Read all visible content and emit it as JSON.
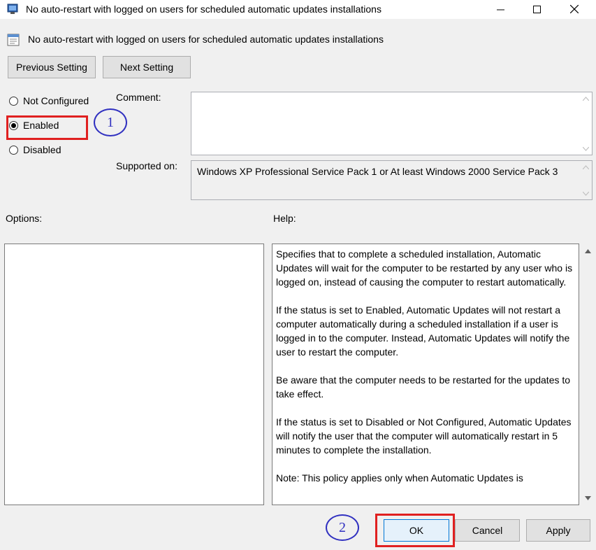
{
  "window": {
    "title": "No auto-restart with logged on users for scheduled automatic updates installations",
    "icons": {
      "app": "policy-icon",
      "minimize": "minimize-icon",
      "maximize": "maximize-icon",
      "close": "close-icon"
    }
  },
  "policy": {
    "name": "No auto-restart with logged on users for scheduled automatic updates installations"
  },
  "nav": {
    "previous_label": "Previous Setting",
    "next_label": "Next Setting"
  },
  "state": {
    "options": [
      {
        "label": "Not Configured",
        "checked": false
      },
      {
        "label": "Enabled",
        "checked": true
      },
      {
        "label": "Disabled",
        "checked": false
      }
    ]
  },
  "annotations": {
    "step1": "1",
    "step2": "2",
    "highlight_color": "#e02020",
    "step_color": "#3030c0"
  },
  "comment": {
    "label": "Comment:",
    "value": ""
  },
  "supported": {
    "label": "Supported on:",
    "value": "Windows XP Professional Service Pack 1 or At least Windows 2000 Service Pack 3"
  },
  "options_panel": {
    "label": "Options:"
  },
  "help_panel": {
    "label": "Help:",
    "paragraphs": [
      "Specifies that to complete a scheduled installation, Automatic Updates will wait for the computer to be restarted by any user who is logged on, instead of causing the computer to restart automatically.",
      "If the status is set to Enabled, Automatic Updates will not restart a computer automatically during a scheduled installation if a user is logged in to the computer. Instead, Automatic Updates will notify the user to restart the computer.",
      "Be aware that the computer needs to be restarted for the updates to take effect.",
      "If the status is set to Disabled or Not Configured, Automatic Updates will notify the user that the computer will automatically restart in 5 minutes to complete the installation.",
      "Note: This policy applies only when Automatic Updates is"
    ]
  },
  "footer": {
    "ok_label": "OK",
    "cancel_label": "Cancel",
    "apply_label": "Apply"
  }
}
